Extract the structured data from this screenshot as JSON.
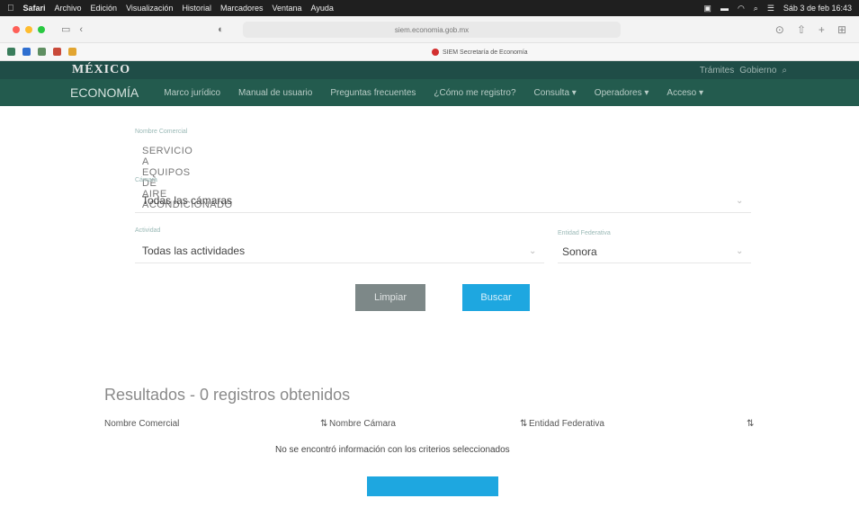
{
  "menubar": {
    "app": "Safari",
    "items": [
      "Archivo",
      "Edición",
      "Visualización",
      "Historial",
      "Marcadores",
      "Ventana",
      "Ayuda"
    ],
    "clock": "Sáb 3 de feb  16:43"
  },
  "browser": {
    "url": "siem.economia.gob.mx",
    "tab_title": "SIEM Secretaría de Economía"
  },
  "site": {
    "logo": "MÉXICO",
    "top_links": [
      "Trámites",
      "Gobierno"
    ],
    "brand": "ECONOMÍA",
    "nav": [
      "Marco jurídico",
      "Manual de usuario",
      "Preguntas frecuentes",
      "¿Cómo me registro?",
      "Consulta ▾",
      "Operadores ▾",
      "Acceso ▾"
    ]
  },
  "form": {
    "search_label": "Nombre Comercial",
    "search_value": "SERVICIO A EQUIPOS DE AIRE ACONDICIONADO",
    "chamber_label": "Cámara",
    "chamber_value": "Todas las cámaras",
    "activity_label": "Actividad",
    "activity_value": "Todas las actividades",
    "state_label": "Entidad Federativa",
    "state_value": "Sonora",
    "clear_label": "Limpiar",
    "search_button": "Buscar"
  },
  "results": {
    "title": "Resultados - 0 registros obtenidos",
    "columns": [
      "Nombre Comercial",
      "Nombre Cámara",
      "Entidad Federativa"
    ],
    "empty_message": "No se encontró información con los criterios seleccionados"
  },
  "colors": {
    "header_dark": "#1f4d47",
    "nav_green": "#235b4e",
    "accent_blue": "#1ea7e0",
    "button_gray": "#7d8888"
  }
}
